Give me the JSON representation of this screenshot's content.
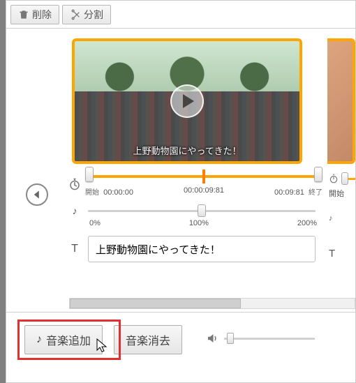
{
  "toolbar": {
    "delete_label": "削除",
    "split_label": "分割"
  },
  "clip": {
    "subtitle": "上野動物園にやってきた！",
    "start_label": "開始",
    "end_label": "終了",
    "t_start": "00:00:00",
    "t_mid": "00:00:09:81",
    "t_end": "00:09:81",
    "vol_0": "0%",
    "vol_100": "100%",
    "vol_200": "200%",
    "title_value": "上野動物園にやってきた！"
  },
  "peek": {
    "start_label": "開始"
  },
  "bottom": {
    "add_music_label": "音楽追加",
    "remove_music_label": "音楽消去"
  },
  "icons": {
    "note": "♪",
    "T": "T"
  }
}
